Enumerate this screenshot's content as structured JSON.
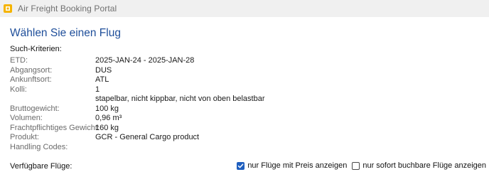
{
  "window": {
    "title": "Air Freight Booking Portal",
    "icon": "app-logo-icon",
    "accent": "#F5B400"
  },
  "page": {
    "heading": "Wählen Sie einen Flug",
    "criteria_label": "Such-Kriterien:",
    "available_flights_label": "Verfügbare Flüge:",
    "heading_color": "#1E4E9A"
  },
  "criteria": [
    {
      "label": "ETD:",
      "value": "2025-JAN-24 - 2025-JAN-28"
    },
    {
      "label": "Abgangsort:",
      "value": "DUS"
    },
    {
      "label": "Ankunftsort:",
      "value": "ATL"
    },
    {
      "label": "Kolli:",
      "value": "1"
    },
    {
      "label": "",
      "value": "stapelbar, nicht kippbar, nicht von oben belastbar"
    },
    {
      "label": "Bruttogewicht:",
      "value": "100 kg"
    },
    {
      "label": "Volumen:",
      "value": "0,96 m³"
    },
    {
      "label": "Frachtpflichtiges Gewicht:",
      "value": "160 kg"
    },
    {
      "label": "Produkt:",
      "value": "GCR - General Cargo product"
    },
    {
      "label": "Handling Codes:",
      "value": ""
    }
  ],
  "filters": [
    {
      "label": "nur Flüge mit Preis anzeigen",
      "checked": true
    },
    {
      "label": "nur sofort buchbare Flüge anzeigen",
      "checked": false
    }
  ]
}
